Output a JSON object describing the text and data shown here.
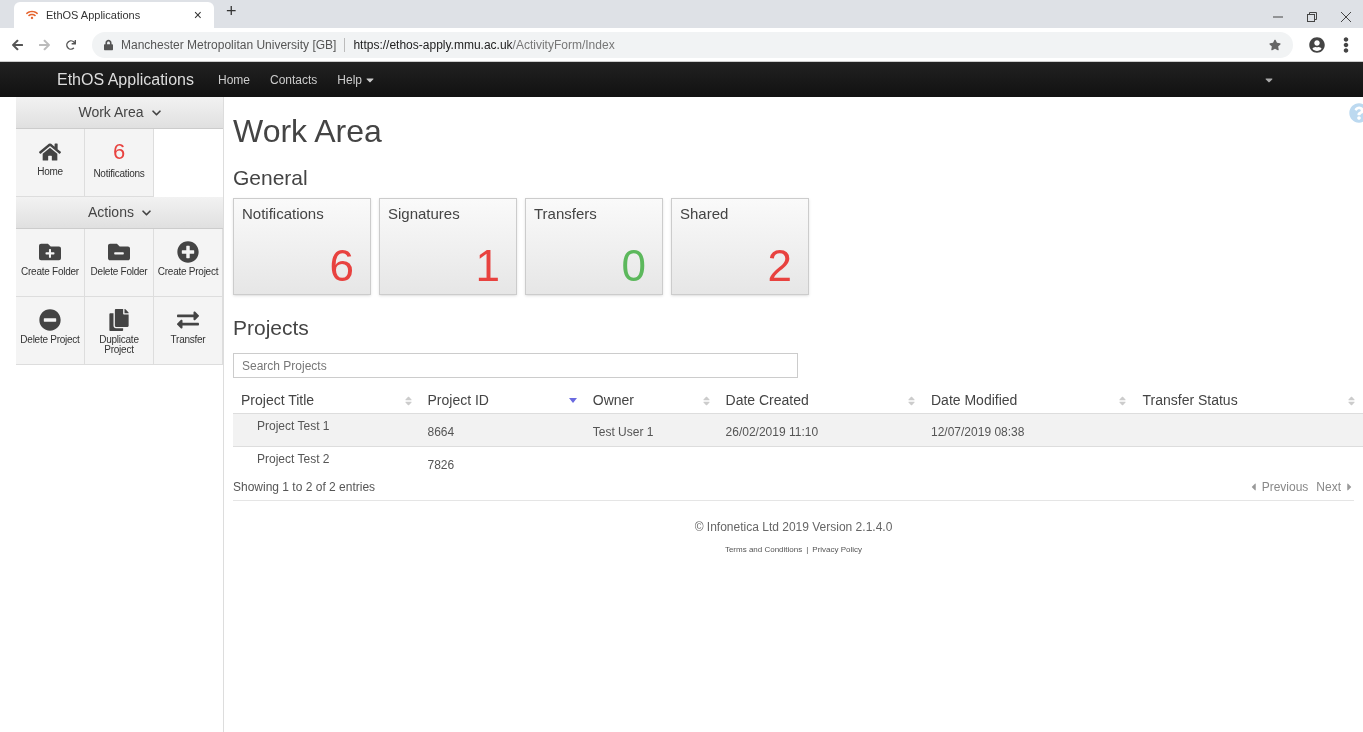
{
  "browser": {
    "tab_title": "EthOS Applications",
    "tab_close": "×",
    "new_tab": "+",
    "site_identity": "Manchester Metropolitan University [GB]",
    "url_host": "https://ethos-apply.mmu.ac.uk",
    "url_path": "/ActivityForm/Index"
  },
  "navbar": {
    "brand": "EthOS Applications",
    "links": [
      {
        "label": "Home",
        "dropdown": false
      },
      {
        "label": "Contacts",
        "dropdown": false
      },
      {
        "label": "Help",
        "dropdown": true
      }
    ]
  },
  "sidebar": {
    "sections": [
      {
        "title": "Work Area",
        "items": [
          {
            "kind": "home",
            "label": "Home"
          },
          {
            "kind": "count",
            "count": "6",
            "label": "Notifications"
          }
        ]
      },
      {
        "title": "Actions",
        "items": [
          {
            "kind": "folder-plus",
            "label": "Create Folder"
          },
          {
            "kind": "folder-minus",
            "label": "Delete Folder"
          },
          {
            "kind": "plus-circle",
            "label": "Create Project"
          },
          {
            "kind": "minus-circle",
            "label": "Delete Project"
          },
          {
            "kind": "duplicate",
            "label": "Duplicate Project"
          },
          {
            "kind": "transfer",
            "label": "Transfer"
          }
        ]
      }
    ]
  },
  "page_title": "Work Area",
  "general": {
    "title": "General",
    "tiles": [
      {
        "label": "Notifications",
        "count": "6",
        "color": "#e8423f"
      },
      {
        "label": "Signatures",
        "count": "1",
        "color": "#e8423f"
      },
      {
        "label": "Transfers",
        "count": "0",
        "color": "#5cb85c"
      },
      {
        "label": "Shared",
        "count": "2",
        "color": "#e8423f"
      }
    ]
  },
  "projects": {
    "title": "Projects",
    "search": {
      "placeholder": "Search Projects"
    },
    "table": {
      "columns": [
        {
          "label": "Project Title",
          "sorted": false
        },
        {
          "label": "Project ID",
          "sorted": true
        },
        {
          "label": "Owner",
          "sorted": false
        },
        {
          "label": "Date Created",
          "sorted": false
        },
        {
          "label": "Date Modified",
          "sorted": false
        },
        {
          "label": "Transfer Status",
          "sorted": false
        }
      ],
      "rows": [
        {
          "selected": true,
          "cells": [
            "Project Test 1",
            "8664",
            "Test User 1",
            "26/02/2019 11:10",
            "12/07/2019 08:38",
            ""
          ]
        },
        {
          "selected": false,
          "cells": [
            "Project Test 2",
            "7826",
            "",
            "",
            "",
            ""
          ]
        }
      ]
    },
    "info": "Showing 1 to 2 of 2 entries",
    "previous": "Previous",
    "next": "Next"
  },
  "footer": {
    "copyright": "© Infonetica Ltd 2019 Version 2.1.4.0",
    "links": [
      "Terms and Conditions",
      "Privacy Policy"
    ],
    "separator": "|"
  }
}
